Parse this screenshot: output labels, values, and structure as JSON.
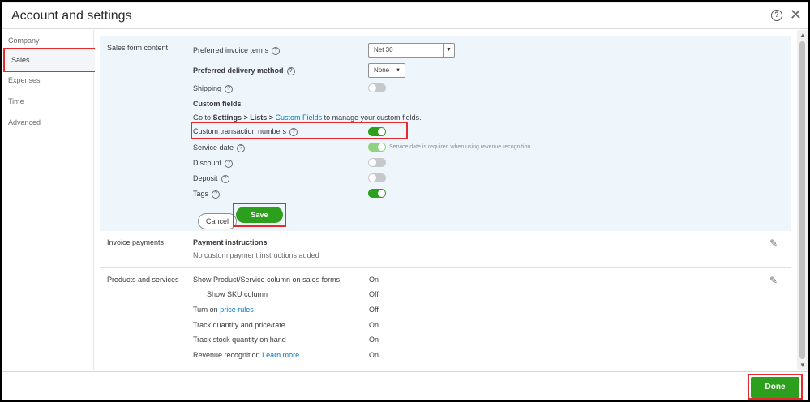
{
  "window": {
    "title": "Account and settings"
  },
  "sidebar": {
    "items": [
      {
        "label": "Company"
      },
      {
        "label": "Sales"
      },
      {
        "label": "Expenses"
      },
      {
        "label": "Time"
      },
      {
        "label": "Advanced"
      }
    ]
  },
  "sales_form": {
    "section_label": "Sales form content",
    "preferred_terms_label": "Preferred invoice terms",
    "preferred_terms_value": "Net 30",
    "delivery_label": "Preferred delivery method",
    "delivery_value": "None",
    "shipping_label": "Shipping",
    "custom_fields_heading": "Custom fields",
    "custom_fields_text_1": "Go to ",
    "custom_fields_settings": "Settings > Lists > ",
    "custom_fields_link": "Custom Fields",
    "custom_fields_text_2": " to manage your custom fields.",
    "custom_txn_label": "Custom transaction numbers",
    "service_date_label": "Service date",
    "service_date_hint": "Service date is required when using revenue recognition.",
    "discount_label": "Discount",
    "deposit_label": "Deposit",
    "tags_label": "Tags",
    "cancel_label": "Cancel",
    "save_label": "Save",
    "toggles": {
      "shipping": false,
      "custom_txn": true,
      "service_date": true,
      "discount": false,
      "deposit": false,
      "tags": true
    }
  },
  "invoice_payments": {
    "section_label": "Invoice payments",
    "heading": "Payment instructions",
    "value": "No custom payment instructions added"
  },
  "products_services": {
    "section_label": "Products and services",
    "rows": [
      {
        "label": "Show Product/Service column on sales forms",
        "value": "On"
      },
      {
        "label": "Show SKU column",
        "value": "Off"
      },
      {
        "label_prefix": "Turn on ",
        "link": "price rules",
        "value": "Off"
      },
      {
        "label": "Track quantity and price/rate",
        "value": "On"
      },
      {
        "label": "Track stock quantity on hand",
        "value": "On"
      },
      {
        "label_prefix": "Revenue recognition ",
        "link": "Learn more",
        "value": "On"
      }
    ]
  },
  "footer": {
    "done_label": "Done"
  },
  "colors": {
    "accent": "#2ca01c",
    "highlight": "#e8292c",
    "link": "#0077c5",
    "section_bg": "#eff6fb"
  }
}
